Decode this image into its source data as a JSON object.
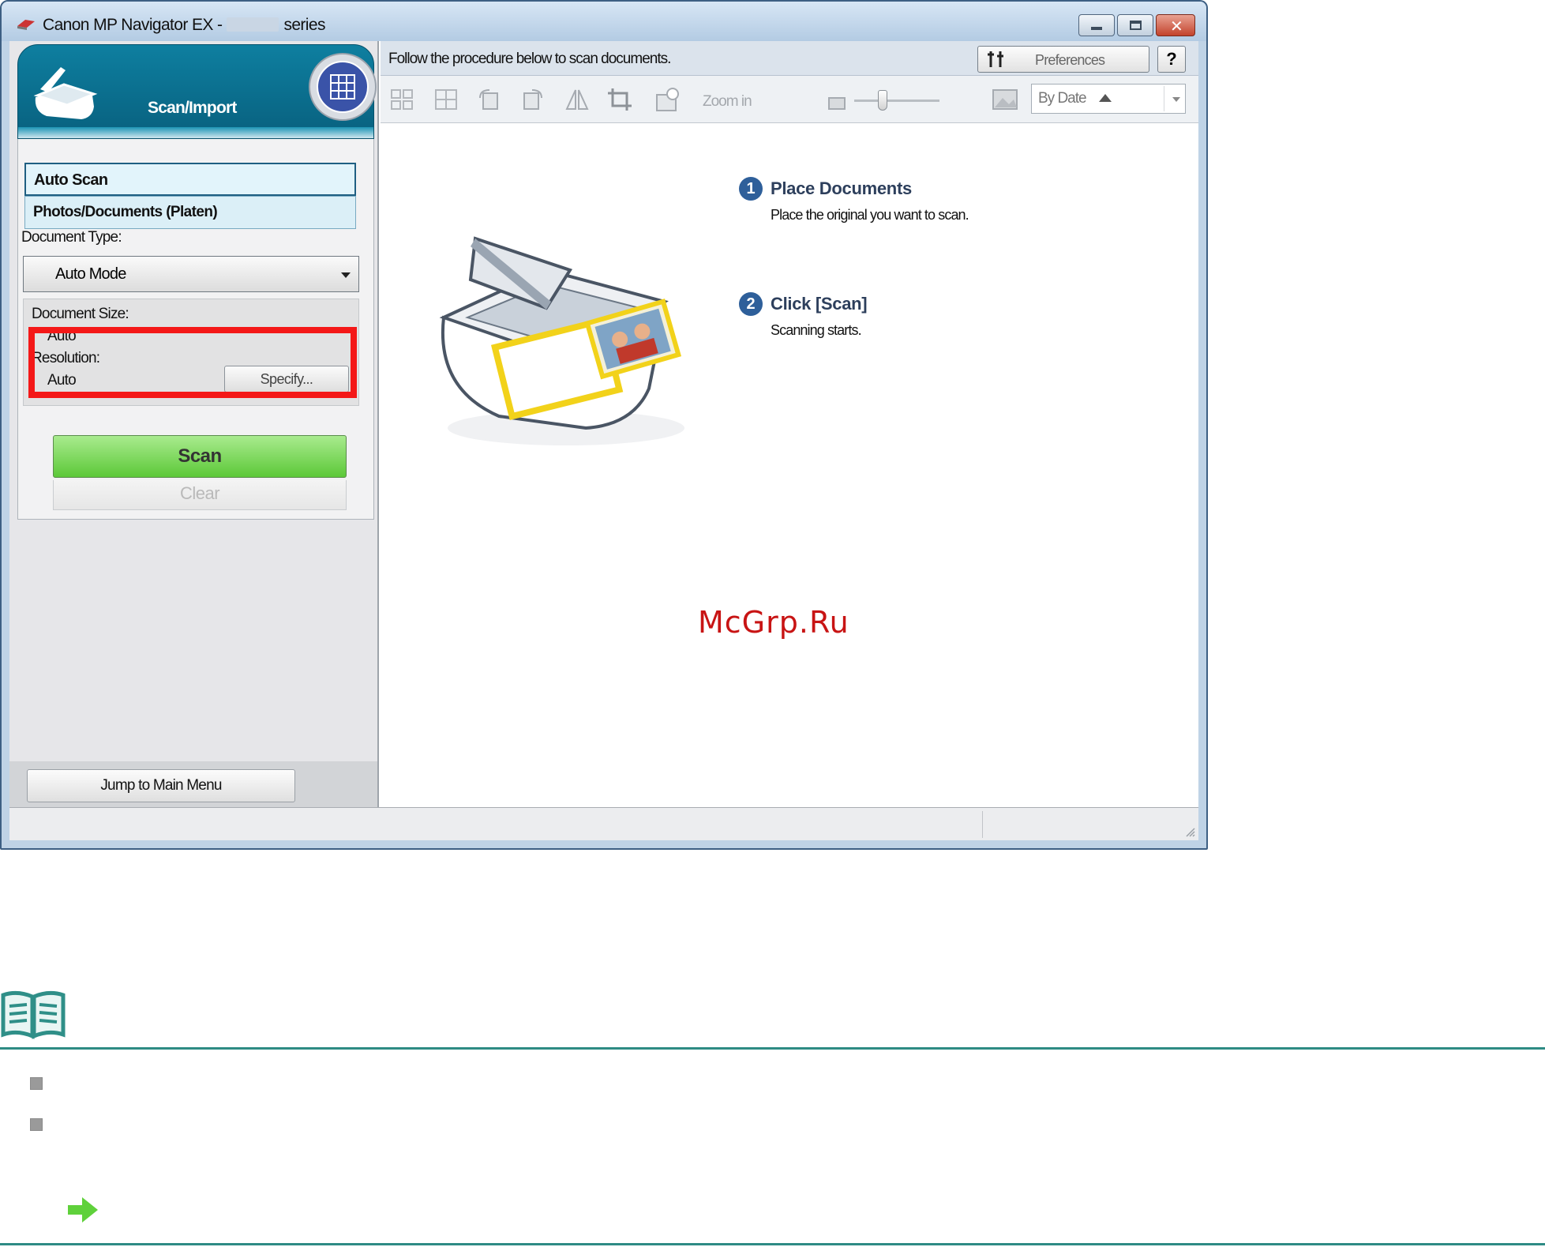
{
  "window": {
    "title_prefix": "Canon MP Navigator EX -",
    "title_suffix": "series"
  },
  "left_pane": {
    "section_title": "Scan/Import",
    "modes": [
      {
        "label": "Auto Scan",
        "selected": true
      },
      {
        "label": "Photos/Documents (Platen)",
        "selected": false
      }
    ],
    "document_type_label": "Document Type:",
    "document_type_value": "Auto Mode",
    "document_size_label": "Document Size:",
    "document_size_value": "Auto",
    "resolution_label": "Resolution:",
    "resolution_value": "Auto",
    "specify_button": "Specify...",
    "scan_button": "Scan",
    "clear_button": "Clear",
    "jump_button": "Jump to Main Menu"
  },
  "right_pane": {
    "instruction": "Follow the procedure below to scan documents.",
    "preferences_button": "Preferences",
    "help_button": "?",
    "toolbar": {
      "zoom_label": "Zoom in",
      "sort_value": "By Date"
    },
    "steps": [
      {
        "number": "1",
        "title": "Place Documents",
        "desc": "Place the original you want to scan."
      },
      {
        "number": "2",
        "title": "Click [Scan]",
        "desc": "Scanning starts."
      }
    ]
  },
  "watermark": "McGrp.Ru",
  "colors": {
    "accent": "#0b7090",
    "scan_green": "#6fd24c",
    "highlight_red": "#f41818",
    "step_blue": "#2e5f9a",
    "rule_teal": "#2e8b84"
  }
}
